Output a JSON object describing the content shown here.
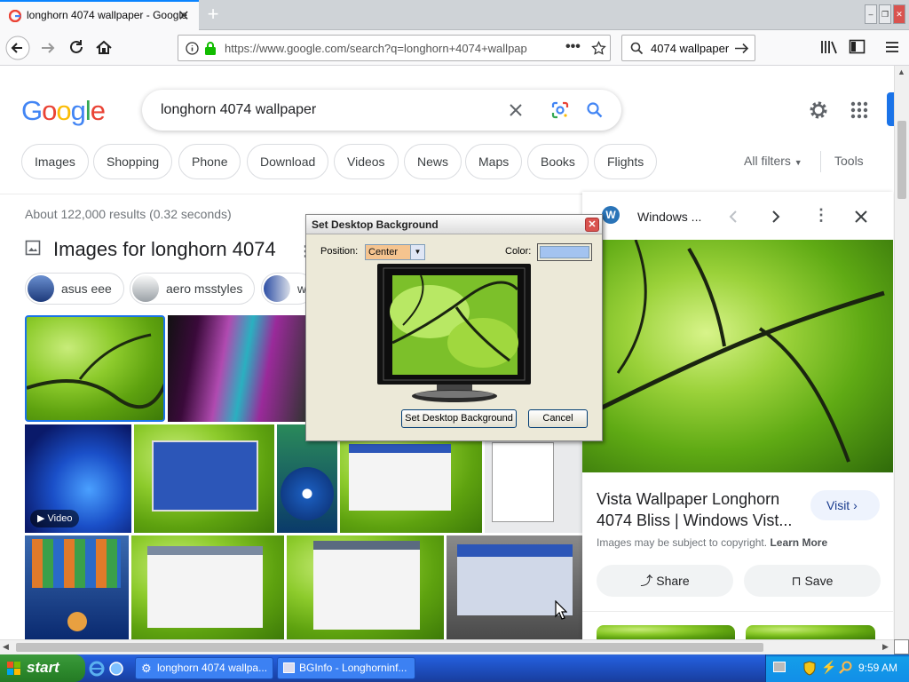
{
  "browser": {
    "tab_title": "longhorn 4074 wallpaper - Google",
    "url": "https://www.google.com/search?q=longhorn+4074+wallpap",
    "search_bar_text": "4074 wallpaper"
  },
  "google": {
    "logo": "Google",
    "query": "longhorn 4074 wallpaper",
    "chips": [
      "Images",
      "Shopping",
      "Phone",
      "Download",
      "Videos",
      "News",
      "Maps",
      "Books",
      "Flights"
    ],
    "all_filters": "All filters",
    "tools": "Tools",
    "stats": "About 122,000 results (0.32 seconds)",
    "images_heading": "Images for longhorn 4074",
    "related": [
      "asus eee",
      "aero msstyles",
      "w"
    ],
    "video_badge": "Video"
  },
  "panel": {
    "site": "Windows ...",
    "title": "Vista Wallpaper Longhorn 4074 Bliss | Windows Vist...",
    "visit": "Visit",
    "copyright": "Images may be subject to copyright.",
    "learn_more": "Learn More",
    "share": "Share",
    "save": "Save"
  },
  "dialog": {
    "title": "Set Desktop Background",
    "position_label": "Position:",
    "position_value": "Center",
    "color_label": "Color:",
    "ok_label": "Set Desktop Background",
    "cancel_label": "Cancel"
  },
  "taskbar": {
    "start": "start",
    "tasks": [
      "longhorn 4074 wallpa...",
      "BGInfo - Longhorninf..."
    ],
    "clock": "9:59 AM"
  },
  "colors": {
    "accent_blue": "#1a73e8",
    "dialog_bg": "#ece9d8",
    "taskbar_blue": "#245edb",
    "start_green": "#2e8b2e"
  }
}
